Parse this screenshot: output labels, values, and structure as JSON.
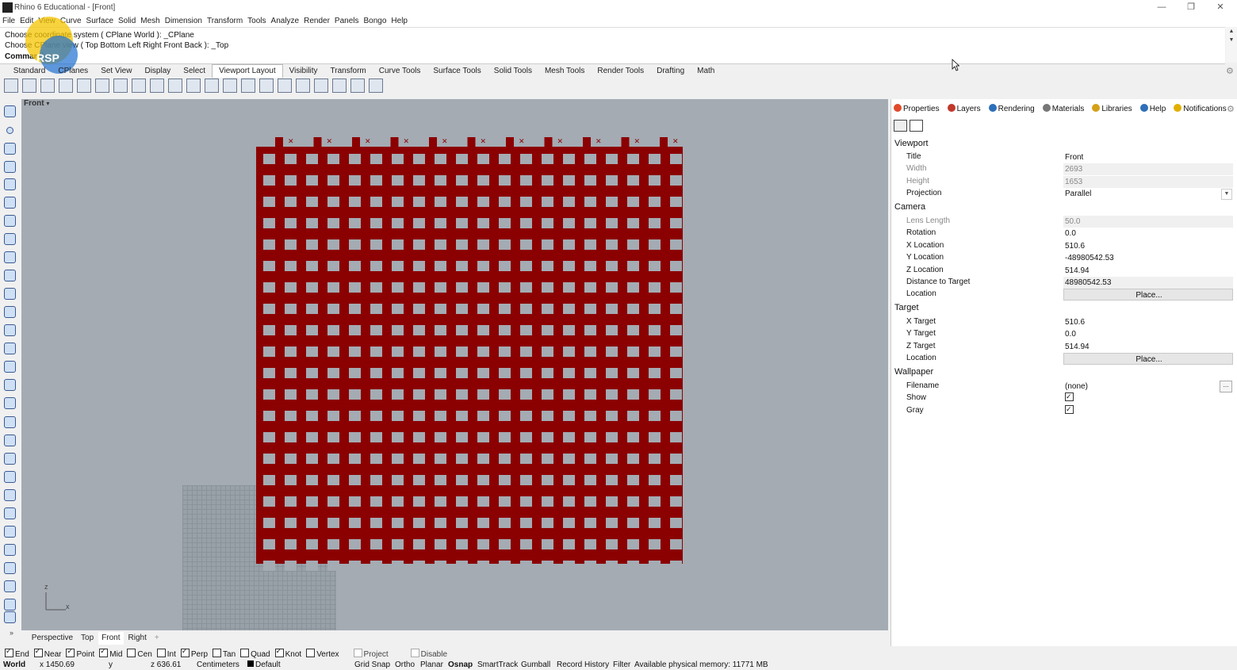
{
  "window": {
    "title": "Rhino 6 Educational - [Front]",
    "minimize": "—",
    "restore": "❐",
    "close": "✕"
  },
  "menu": [
    "File",
    "Edit",
    "View",
    "Curve",
    "Surface",
    "Solid",
    "Mesh",
    "Dimension",
    "Transform",
    "Tools",
    "Analyze",
    "Render",
    "Panels",
    "Bongo",
    "Help"
  ],
  "command": {
    "line1": "Choose coordinate system ( CPlane  World ): _CPlane",
    "line2": "Choose CPlane view ( Top  Bottom  Left  Right  Front  Back ): _Top",
    "prompt": "Command:"
  },
  "toolbar_tabs": [
    "Standard",
    "CPlanes",
    "Set View",
    "Display",
    "Select",
    "Viewport Layout",
    "Visibility",
    "Transform",
    "Curve Tools",
    "Surface Tools",
    "Solid Tools",
    "Mesh Tools",
    "Render Tools",
    "Drafting",
    "Math"
  ],
  "active_toolbar_tab": "Viewport Layout",
  "viewport": {
    "name": "Front",
    "dropdown": "▾",
    "axis_z": "z",
    "axis_x": "x"
  },
  "viewport_tabs": [
    "Perspective",
    "Top",
    "Front",
    "Right"
  ],
  "viewport_tab_add": "+",
  "osnap": [
    {
      "label": "End",
      "checked": true
    },
    {
      "label": "Near",
      "checked": true
    },
    {
      "label": "Point",
      "checked": true
    },
    {
      "label": "Mid",
      "checked": true
    },
    {
      "label": "Cen",
      "checked": false
    },
    {
      "label": "Int",
      "checked": false
    },
    {
      "label": "Perp",
      "checked": true
    },
    {
      "label": "Tan",
      "checked": false
    },
    {
      "label": "Quad",
      "checked": false
    },
    {
      "label": "Knot",
      "checked": true
    },
    {
      "label": "Vertex",
      "checked": false
    },
    {
      "label": "Project",
      "checked": false,
      "disabled": true
    },
    {
      "label": "Disable",
      "checked": false,
      "disabled": true
    }
  ],
  "status": {
    "cplane": "World",
    "x": "x 1450.69",
    "y": "y",
    "z": "z 636.61",
    "units": "Centimeters",
    "layer": "Default",
    "grid_snap": "Grid Snap",
    "ortho": "Ortho",
    "planar": "Planar",
    "osnap": "Osnap",
    "smarttrack": "SmartTrack",
    "gumball": "Gumball",
    "record_history": "Record History",
    "filter": "Filter",
    "memory": "Available physical memory: 11771 MB"
  },
  "panel": {
    "tabs": [
      {
        "label": "Properties",
        "color": "#e04a2a"
      },
      {
        "label": "Layers",
        "color": "#c0392b"
      },
      {
        "label": "Rendering",
        "color": "#2d6fb8"
      },
      {
        "label": "Materials",
        "color": "#777777"
      },
      {
        "label": "Libraries",
        "color": "#d4a017"
      },
      {
        "label": "Help",
        "color": "#2d6fb8"
      },
      {
        "label": "Notifications",
        "color": "#e0b000"
      }
    ],
    "sections": {
      "viewport": {
        "heading": "Viewport",
        "title_label": "Title",
        "title_value": "Front",
        "width_label": "Width",
        "width_value": "2693",
        "height_label": "Height",
        "height_value": "1653",
        "projection_label": "Projection",
        "projection_value": "Parallel"
      },
      "camera": {
        "heading": "Camera",
        "lens_label": "Lens Length",
        "lens_value": "50.0",
        "rotation_label": "Rotation",
        "rotation_value": "0.0",
        "xloc_label": "X Location",
        "xloc_value": "510.6",
        "yloc_label": "Y Location",
        "yloc_value": "-48980542.53",
        "zloc_label": "Z Location",
        "zloc_value": "514.94",
        "dist_label": "Distance to Target",
        "dist_value": "48980542.53",
        "location_label": "Location",
        "location_button": "Place..."
      },
      "target": {
        "heading": "Target",
        "xt_label": "X Target",
        "xt_value": "510.6",
        "yt_label": "Y Target",
        "yt_value": "0.0",
        "zt_label": "Z Target",
        "zt_value": "514.94",
        "location_label": "Location",
        "location_button": "Place..."
      },
      "wallpaper": {
        "heading": "Wallpaper",
        "filename_label": "Filename",
        "filename_value": "(none)",
        "filename_button": "...",
        "show_label": "Show",
        "show_checked": true,
        "gray_label": "Gray",
        "gray_checked": true
      }
    }
  },
  "logo_text": "RSP",
  "colors": {
    "object": "#8b0000",
    "viewport_bg": "#a4abb3"
  }
}
